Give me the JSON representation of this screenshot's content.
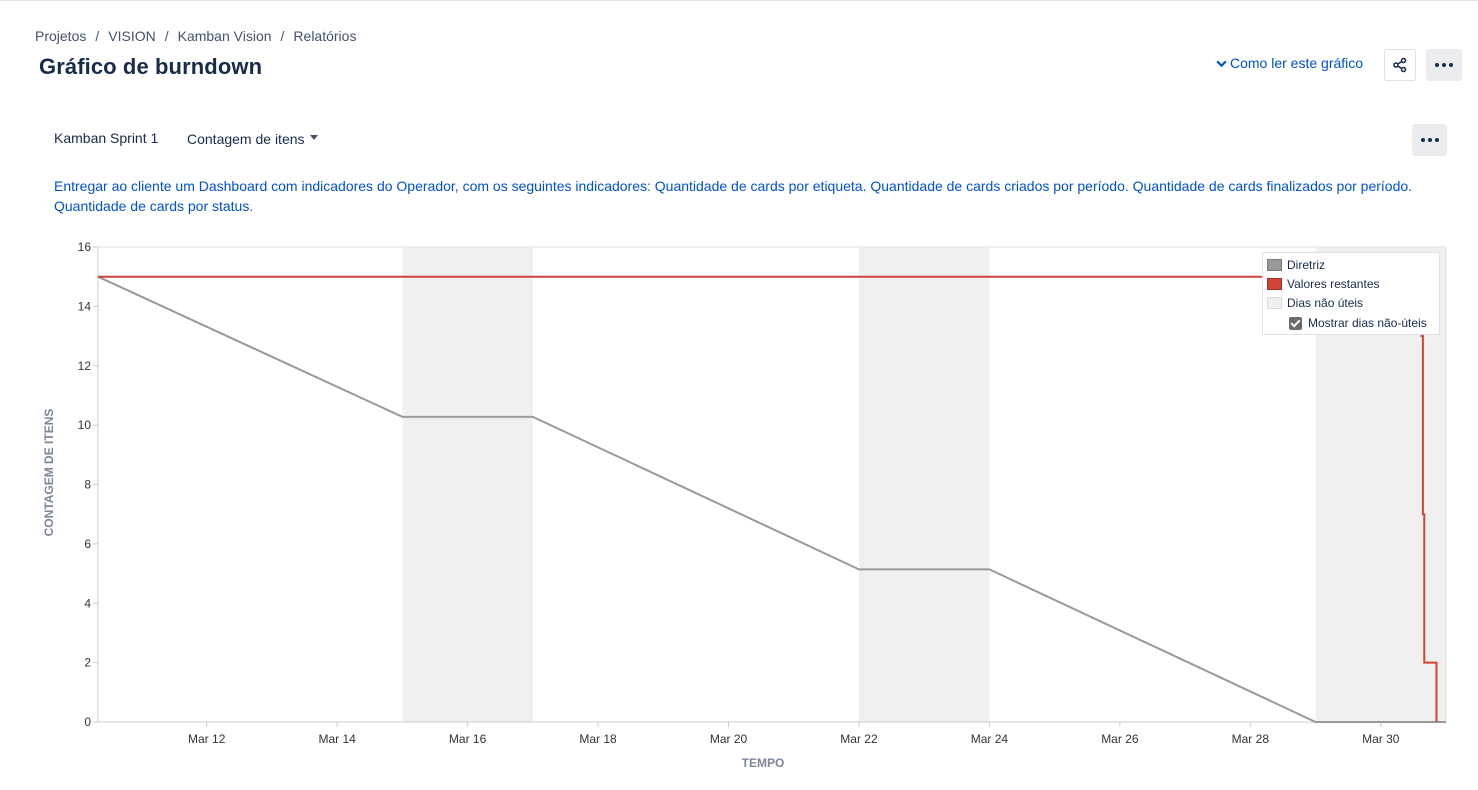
{
  "breadcrumb": [
    "Projetos",
    "VISION",
    "Kamban Vision",
    "Relatórios"
  ],
  "breadcrumb_sep": "/",
  "page_title": "Gráfico de burndown",
  "how_to_read": "Como ler este gráfico",
  "sprint": "Kamban Sprint 1",
  "estimation": "Contagem de itens",
  "sprint_goal": "Entregar ao cliente um Dashboard com indicadores do Operador, com os seguintes indicadores: Quantidade de cards por etiqueta. Quantidade de cards criados por período. Quantidade de cards finalizados por período. Quantidade de cards por status.",
  "legend": {
    "guideline": "Diretriz",
    "remaining": "Valores restantes",
    "non_working": "Dias não úteis",
    "show_non_working": "Mostrar dias não-úteis",
    "show_non_working_checked": true
  },
  "colors": {
    "guideline": "#999999",
    "remaining": "#d04437",
    "non_working": "#f0f0f0",
    "link": "#0052cc"
  },
  "chart_data": {
    "type": "line",
    "xlabel": "TEMPO",
    "ylabel": "CONTAGEM DE ITENS",
    "ylim": [
      0,
      16
    ],
    "yticks": [
      0,
      2,
      4,
      6,
      8,
      10,
      12,
      14,
      16
    ],
    "xlim": [
      "2025-03-10T08:00",
      "2025-03-31T00:00"
    ],
    "xticks": [
      {
        "date": "2025-03-12",
        "label": "Mar 12"
      },
      {
        "date": "2025-03-14",
        "label": "Mar 14"
      },
      {
        "date": "2025-03-16",
        "label": "Mar 16"
      },
      {
        "date": "2025-03-18",
        "label": "Mar 18"
      },
      {
        "date": "2025-03-20",
        "label": "Mar 20"
      },
      {
        "date": "2025-03-22",
        "label": "Mar 22"
      },
      {
        "date": "2025-03-24",
        "label": "Mar 24"
      },
      {
        "date": "2025-03-26",
        "label": "Mar 26"
      },
      {
        "date": "2025-03-28",
        "label": "Mar 28"
      },
      {
        "date": "2025-03-30",
        "label": "Mar 30"
      }
    ],
    "non_working_days": [
      [
        "2025-03-15",
        "2025-03-17"
      ],
      [
        "2025-03-22",
        "2025-03-24"
      ],
      [
        "2025-03-29",
        "2025-03-31"
      ]
    ],
    "grid": false,
    "legend_position": "top-right",
    "series": [
      {
        "name": "Diretriz",
        "step": false,
        "points": [
          {
            "x": "2025-03-10T08:00",
            "y": 15
          },
          {
            "x": "2025-03-15T00:00",
            "y": 10.28
          },
          {
            "x": "2025-03-17T00:00",
            "y": 10.28
          },
          {
            "x": "2025-03-22T00:00",
            "y": 5.14
          },
          {
            "x": "2025-03-24T00:00",
            "y": 5.14
          },
          {
            "x": "2025-03-29T00:00",
            "y": 0
          },
          {
            "x": "2025-03-31T00:00",
            "y": 0
          }
        ]
      },
      {
        "name": "Valores restantes",
        "step": true,
        "points": [
          {
            "x": "2025-03-10T08:00",
            "y": 15
          },
          {
            "x": "2025-03-30T15:00",
            "y": 15
          },
          {
            "x": "2025-03-30T15:00",
            "y": 13
          },
          {
            "x": "2025-03-30T15:30",
            "y": 9
          },
          {
            "x": "2025-03-30T15:30",
            "y": 7
          },
          {
            "x": "2025-03-30T16:00",
            "y": 2
          },
          {
            "x": "2025-03-30T20:30",
            "y": 0
          }
        ]
      }
    ]
  }
}
